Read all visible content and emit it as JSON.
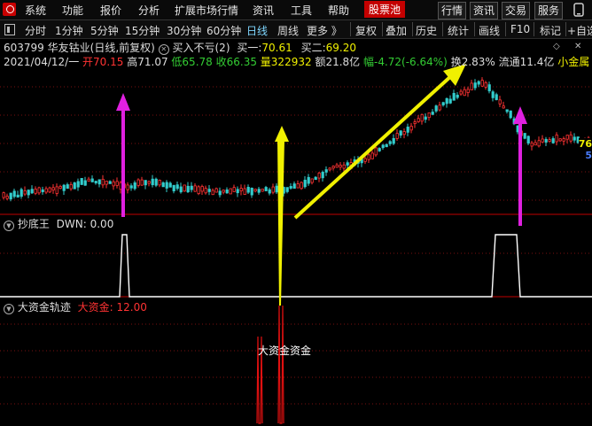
{
  "menu": {
    "items": [
      "系统",
      "功能",
      "报价",
      "分析",
      "扩展市场行情",
      "资讯",
      "工具",
      "帮助",
      "股票池"
    ],
    "right_buttons": [
      "行情",
      "资讯",
      "交易",
      "服务"
    ],
    "right_icon": "phone-icon"
  },
  "toolbar": {
    "periods": [
      "分时",
      "1分钟",
      "5分钟",
      "15分钟",
      "30分钟",
      "60分钟",
      "日线",
      "周线",
      "更多 》"
    ],
    "active_period": "日线",
    "actions": [
      "复权",
      "叠加",
      "历史",
      "统计",
      "画线",
      "F10",
      "标记",
      "+自选"
    ]
  },
  "quote": {
    "code": "603799",
    "name": "华友钴业",
    "mode": "(日线,前复权)",
    "signal": "买入不亏(2)",
    "buy1_label": "买一:",
    "buy1_value": "70.61",
    "buy2_label": "买二:",
    "buy2_value": "69.20",
    "date": "2021/04/12/一",
    "open": "开70.15",
    "high": "高71.07",
    "low": "低65.78",
    "close": "收66.35",
    "volume": "量322932",
    "amount": "额21.8亿",
    "change": "幅-4.72(-6.64%)",
    "turnover": "换2.83%",
    "float_cap": "流通11.4亿",
    "tag": "小金属"
  },
  "price_axis_labels": [
    "76",
    "5"
  ],
  "indicator1": {
    "name": "抄底王",
    "value_label": "DWN: 0.00"
  },
  "indicator2": {
    "name": "大资金轨迹",
    "value_label": "大资金: 12.00",
    "annotation": "大资金资金"
  },
  "colors": {
    "up": "#ff3333",
    "down": "#33cccc",
    "menu_active": "#c40000",
    "arrow_magenta": "#e020e0",
    "arrow_yellow": "#f0f000",
    "separator": "#c00000"
  }
}
